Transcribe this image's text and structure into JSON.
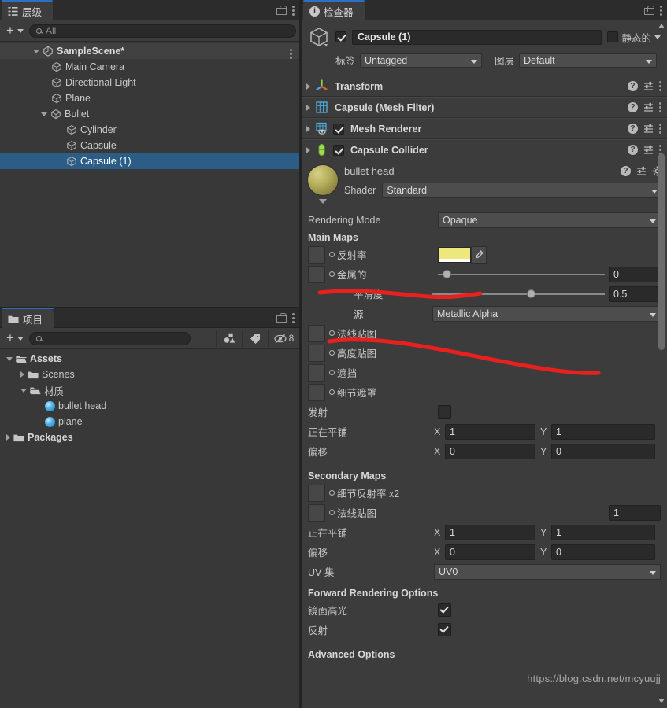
{
  "hierarchy": {
    "tab_label": "层级",
    "tab_icon": "hierarchy-icon",
    "search_value": "All",
    "add_label": "+",
    "scene": {
      "name": "SampleScene*",
      "icon": "unity-logo-icon"
    },
    "items": [
      {
        "label": "Main Camera",
        "depth": 2,
        "expandable": false,
        "selected": false
      },
      {
        "label": "Directional Light",
        "depth": 2,
        "expandable": false,
        "selected": false
      },
      {
        "label": "Plane",
        "depth": 2,
        "expandable": false,
        "selected": false
      },
      {
        "label": "Bullet",
        "depth": 2,
        "expandable": true,
        "selected": false
      },
      {
        "label": "Cylinder",
        "depth": 3,
        "expandable": false,
        "selected": false
      },
      {
        "label": "Capsule",
        "depth": 3,
        "expandable": false,
        "selected": false
      },
      {
        "label": "Capsule (1)",
        "depth": 3,
        "expandable": false,
        "selected": true
      }
    ]
  },
  "project": {
    "tab_label": "项目",
    "search_value": "",
    "hidden_count": "8",
    "items": [
      {
        "label": "Assets",
        "depth": 0,
        "kind": "folder",
        "expanded": true,
        "bold": true
      },
      {
        "label": "Scenes",
        "depth": 1,
        "kind": "folder",
        "expanded": false,
        "bold": false
      },
      {
        "label": "材质",
        "depth": 1,
        "kind": "folder",
        "expanded": true,
        "bold": false
      },
      {
        "label": "bullet head",
        "depth": 2,
        "kind": "material",
        "expanded": null,
        "bold": false
      },
      {
        "label": "plane",
        "depth": 2,
        "kind": "material",
        "expanded": null,
        "bold": false
      },
      {
        "label": "Packages",
        "depth": 0,
        "kind": "folder",
        "expanded": false,
        "bold": true
      }
    ]
  },
  "inspector": {
    "tab_label": "检查器",
    "object": {
      "name": "Capsule (1)",
      "enabled": true,
      "static_label": "静态的",
      "static_checked": false,
      "tag_label": "标签",
      "tag_value": "Untagged",
      "layer_label": "图层",
      "layer_value": "Default"
    },
    "components": [
      {
        "title": "Transform",
        "icon": "transform-gizmo-icon",
        "has_checkbox": false,
        "checked": false
      },
      {
        "title": "Capsule (Mesh Filter)",
        "icon": "mesh-filter-icon",
        "has_checkbox": false,
        "checked": false
      },
      {
        "title": "Mesh Renderer",
        "icon": "mesh-renderer-icon",
        "has_checkbox": true,
        "checked": true
      },
      {
        "title": "Capsule Collider",
        "icon": "capsule-collider-icon",
        "has_checkbox": true,
        "checked": true
      }
    ],
    "material": {
      "name": "bullet head",
      "shader_label": "Shader",
      "shader_value": "Standard",
      "rendering_mode_label": "Rendering Mode",
      "rendering_mode_value": "Opaque",
      "main_maps_header": "Main Maps",
      "albedo_label": "反射率",
      "albedo_color": "#ece87c",
      "metallic_label": "金属的",
      "metallic_value": "0",
      "metallic_pct": 3,
      "smoothness_label": "平滑度",
      "smoothness_value": "0.5",
      "smoothness_pct": 55,
      "source_label": "源",
      "source_value": "Metallic Alpha",
      "normal_map_label": "法线贴图",
      "height_map_label": "高度贴图",
      "occlusion_label": "遮挡",
      "detail_mask_label": "细节遮罩",
      "emission_label": "发射",
      "emission_color": "#2e2e2e",
      "tiling_label": "正在平铺",
      "tiling_x": "1",
      "tiling_y": "1",
      "offset_label": "偏移",
      "offset_x": "0",
      "offset_y": "0",
      "secondary_maps_header": "Secondary Maps",
      "detail_albedo_label": "细节反射率 x2",
      "secondary_normal_label": "法线贴图",
      "secondary_normal_value": "1",
      "sec_tiling_label": "正在平铺",
      "sec_tiling_x": "1",
      "sec_tiling_y": "1",
      "sec_offset_label": "偏移",
      "sec_offset_x": "0",
      "sec_offset_y": "0",
      "uv_set_label": "UV 集",
      "uv_set_value": "UV0",
      "forward_header": "Forward Rendering Options",
      "specular_label": "镜面高光",
      "specular_checked": true,
      "reflections_label": "反射",
      "reflections_checked": true,
      "advanced_header": "Advanced Options",
      "x_axis": "X",
      "y_axis": "Y"
    }
  },
  "watermark": "https://blog.csdn.net/mcyuujj",
  "colors": {
    "selection_blue": "#2c5d87",
    "tab_accent": "#2c6fc4",
    "annotation_red": "#e8201e",
    "panel_bg": "#383838",
    "inspector_bg": "#3c3c3c"
  }
}
